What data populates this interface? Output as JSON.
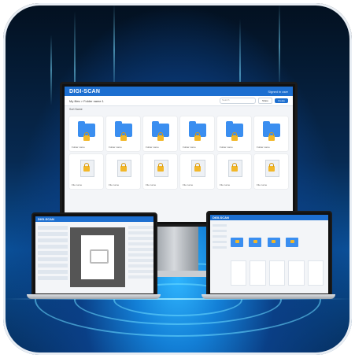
{
  "main_app": {
    "brand": "DIGI-SCAN",
    "user": "Signed in user",
    "breadcrumb": "My files  >  Folder name 1",
    "search_placeholder": "Search",
    "btn_share": "Share",
    "btn_create": "Create",
    "subbar": "Sort  Name",
    "folder_labels": [
      "Folder name",
      "Folder name",
      "Folder name",
      "Folder name",
      "Folder name",
      "Folder name"
    ],
    "file_labels": [
      "File name",
      "File name",
      "File name",
      "File name",
      "File name",
      "File name"
    ]
  },
  "left_laptop": {
    "brand": "DIGI-SCAN"
  },
  "right_laptop": {
    "brand": "DIGI-SCAN"
  }
}
